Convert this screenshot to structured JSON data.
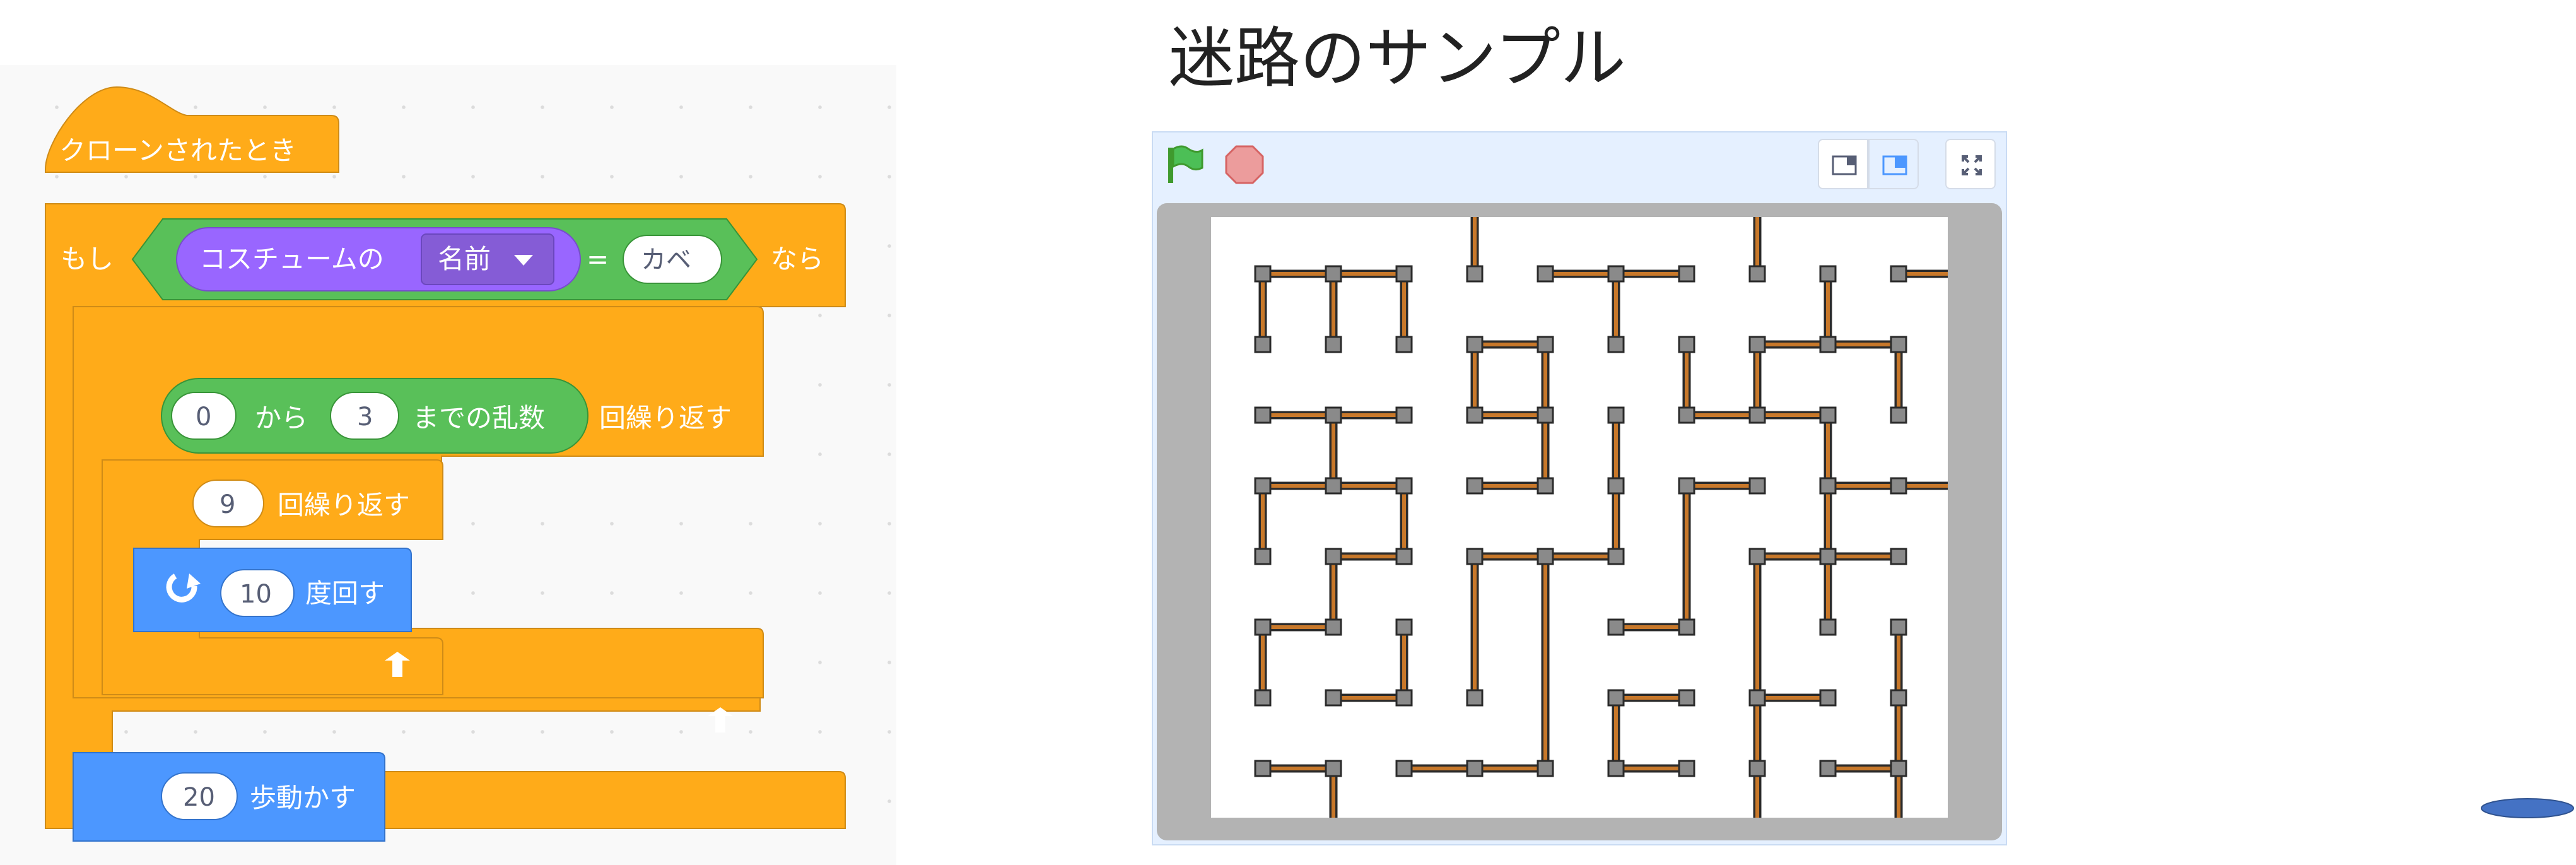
{
  "heading": "迷路のサンプル",
  "blocks": {
    "hat_label": "クローンされたとき",
    "if_label": "もし",
    "costume_reporter_label": "コスチュームの",
    "costume_dropdown_value": "名前",
    "equals_symbol": "=",
    "equals_value": "カベ",
    "then_label": "なら",
    "random_from_value": "0",
    "random_from_label": "から",
    "random_to_value": "3",
    "random_to_label": "までの乱数",
    "repeat_label": "回繰り返す",
    "inner_repeat_value": "9",
    "inner_repeat_label": "回繰り返す",
    "turn_value": "10",
    "turn_label": "度回す",
    "move_value": "20",
    "move_label": "歩動かす"
  },
  "stage": {
    "green_flag_icon": "green-flag-icon",
    "stop_icon": "stop-icon",
    "small_stage_icon": "small-stage-icon",
    "normal_stage_icon": "normal-stage-icon",
    "fullscreen_icon": "fullscreen-icon"
  },
  "colors": {
    "events_orange": "#ffab19",
    "control_orange": "#ffab19",
    "operator_green": "#59c059",
    "looks_purple": "#9966ff",
    "motion_blue": "#4c97ff",
    "wall_orange": "#c8782a",
    "joint_gray": "#8a8a8a"
  }
}
